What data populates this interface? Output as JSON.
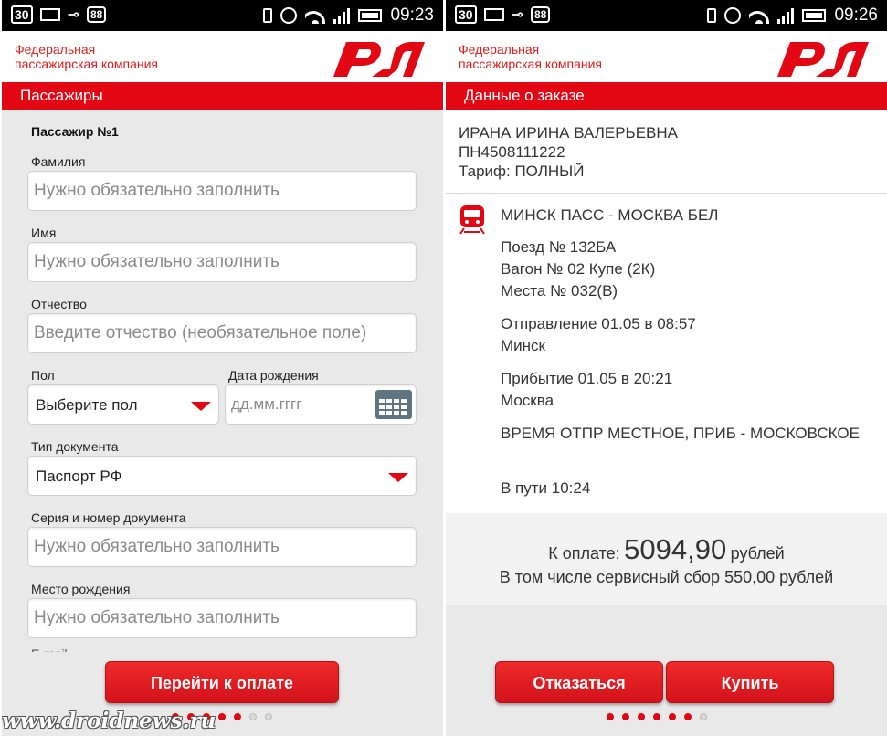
{
  "left": {
    "status": {
      "badge": "30",
      "badge2": "88",
      "time": "09:23"
    },
    "brand": {
      "line1": "Федеральная",
      "line2": "пассажирская компания"
    },
    "title": "Пассажиры",
    "passenger_title": "Пассажир №1",
    "fields": {
      "surname": {
        "label": "Фамилия",
        "placeholder": "Нужно обязательно заполнить"
      },
      "name": {
        "label": "Имя",
        "placeholder": "Нужно обязательно заполнить"
      },
      "patronymic": {
        "label": "Отчество",
        "placeholder": "Введите отчество (необязательное поле)"
      },
      "gender": {
        "label": "Пол",
        "value": "Выберите пол"
      },
      "birth_date": {
        "label": "Дата рождения",
        "placeholder": "дд.мм.гггг"
      },
      "doc_type": {
        "label": "Тип документа",
        "value": "Паспорт РФ"
      },
      "doc_number": {
        "label": "Серия и номер документа",
        "placeholder": "Нужно обязательно заполнить"
      },
      "birth_place": {
        "label": "Место рождения",
        "placeholder": "Нужно обязательно заполнить"
      },
      "partial": {
        "label": "E-mail"
      }
    },
    "button": "Перейти к оплате",
    "pager": {
      "total": 7,
      "active": 5
    }
  },
  "right": {
    "status": {
      "badge": "30",
      "badge2": "88",
      "time": "09:26"
    },
    "brand": {
      "line1": "Федеральная",
      "line2": "пассажирская компания"
    },
    "title": "Данные о заказе",
    "person": {
      "name": "ИРАНА ИРИНА ВАЛЕРЬЕВНА",
      "document": "ПН4508111222",
      "tariff": "Тариф: ПОЛНЫЙ"
    },
    "route": "МИНСК ПАСС - МОСКВА БЕЛ",
    "train": "Поезд № 132БА",
    "car": "Вагон № 02 Купе (2К)",
    "seats": "Места № 032(В)",
    "departure": "Отправление 01.05 в 08:57",
    "departure_city": "Минск",
    "arrival": "Прибытие 01.05 в 20:21",
    "arrival_city": "Москва",
    "time_note": "ВРЕМЯ ОТПР МЕСТНОЕ, ПРИБ - МОСКОВСКОЕ",
    "travel_time": "В пути 10:24",
    "payment": {
      "label": "К оплате:",
      "amount": "5094,90",
      "currency": "рублей",
      "service_fee": "В том числе сервисный сбор 550,00 рублей"
    },
    "cancel_button": "Отказаться",
    "buy_button": "Купить",
    "pager": {
      "total": 7,
      "active": 6
    }
  },
  "watermark": "www.droidnews.ru",
  "colors": {
    "brand_red": "#e30613",
    "background": "#e9e9e9"
  }
}
